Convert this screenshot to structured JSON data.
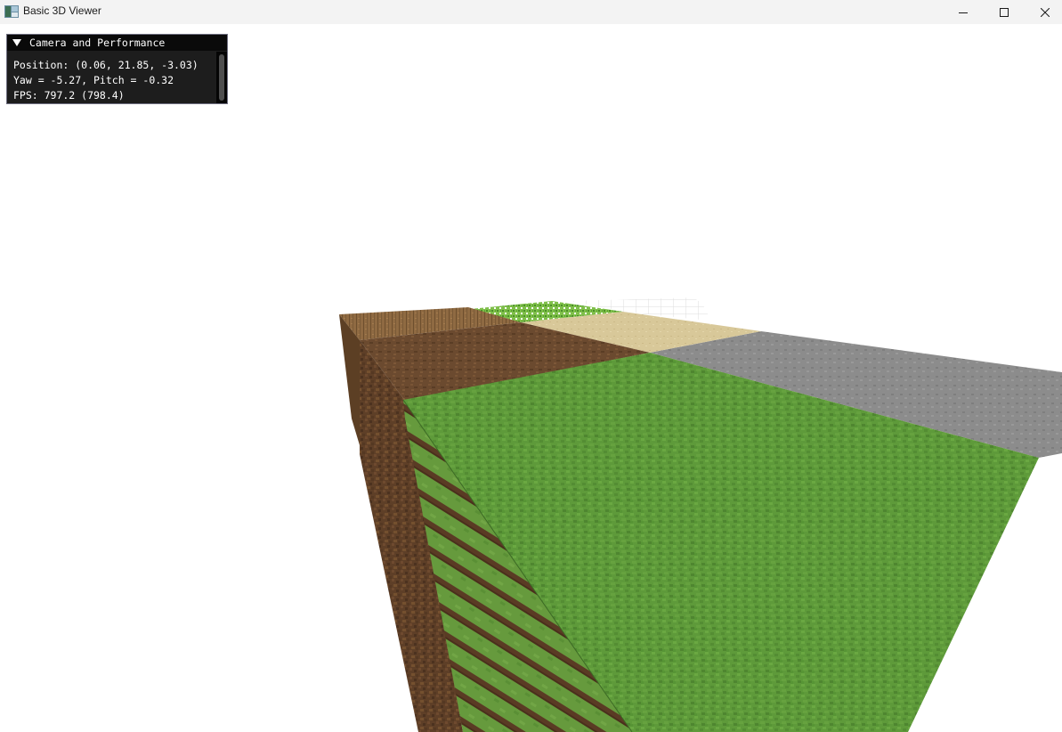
{
  "window": {
    "title": "Basic 3D Viewer",
    "controls": [
      "minimize",
      "maximize",
      "close"
    ]
  },
  "imgui": {
    "panel_title": "Camera and Performance",
    "position_text": "Position: (0.06, 21.85, -3.03)",
    "orientation_text": "Yaw = -5.27, Pitch = -0.32",
    "fps_text": "FPS: 797.2 (798.4)"
  },
  "scene": {
    "blocks": [
      "oak-planks",
      "dirt",
      "grass",
      "sand",
      "stone",
      "leaves",
      "glass"
    ],
    "colors": {
      "grass_top": "#5e9a3a",
      "grass_side": "#6d9b3e",
      "dirt": "#6b4a2f",
      "dirt_dark": "#4f3320",
      "planks": "#8f6a42",
      "sand": "#d8c899",
      "stone": "#8c8c8c",
      "leaves": "#5fa83a",
      "sky": "#ffffff"
    }
  }
}
